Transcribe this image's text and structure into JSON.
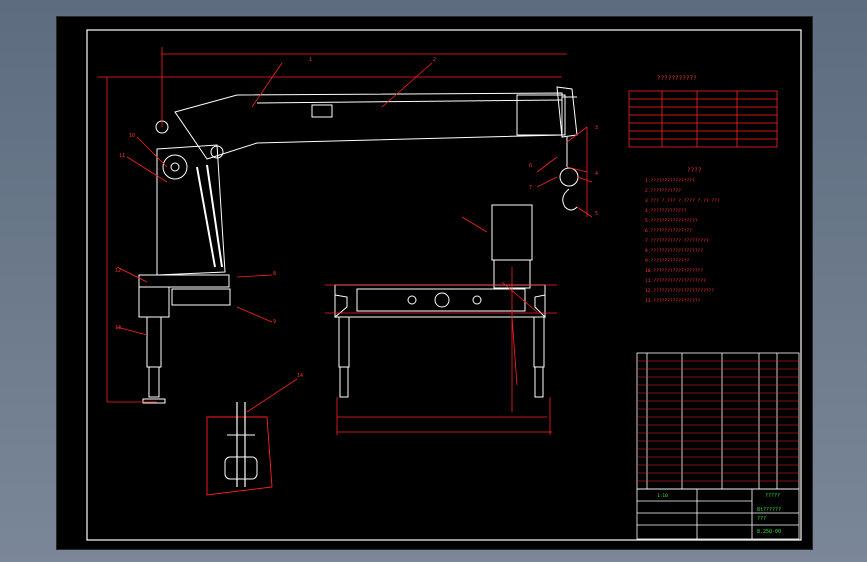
{
  "drawing": {
    "tech_title_marks": "???????????",
    "tech_requirements_title": "????",
    "requirements": [
      "1.????????????????",
      "2.???????????",
      "3.??? ?.??? ?.???? ?.?? ???",
      "4.?????????????",
      "5.?????????????????",
      "6.???????????????",
      "7.??????????? ?????????",
      "8.???????????????????",
      "9.??????????????",
      "10.??????????????????",
      "11.???????????????????",
      "12.??????????????????????",
      "13.?????????????????"
    ],
    "part_callouts": [
      "1",
      "2",
      "3",
      "4",
      "5",
      "6",
      "7",
      "8",
      "9",
      "10",
      "11",
      "12",
      "13",
      "14"
    ],
    "title_block": {
      "school": "?????",
      "drawing_name": "8t??????",
      "sub_name": "???",
      "drawing_no": "8.25Q-00",
      "scale": "1:10"
    }
  },
  "colors": {
    "sheet": "#000000",
    "line": "#ffffff",
    "dimension": "#ff2020",
    "border": "#ffffff",
    "accent_green": "#30e030"
  }
}
